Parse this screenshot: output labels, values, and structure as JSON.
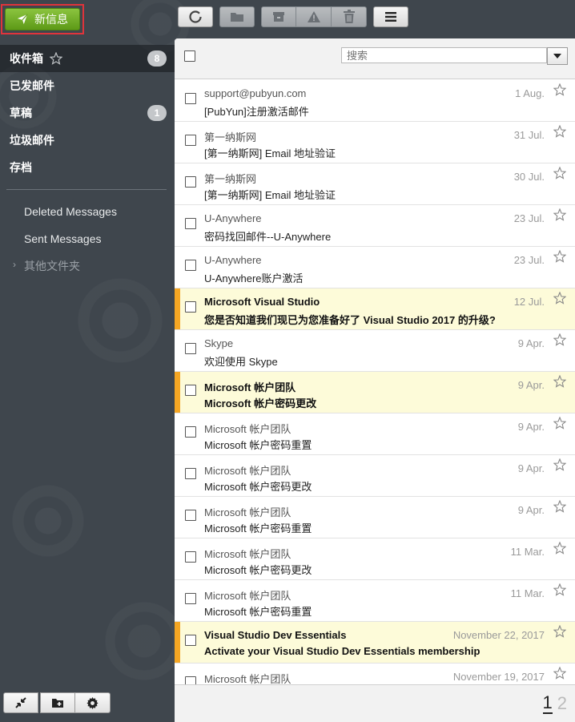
{
  "compose": {
    "label": "新信息"
  },
  "toolbar": {
    "buttons": [
      "refresh-icon",
      "folder-icon",
      "archive-icon",
      "spam-icon",
      "trash-icon",
      "menu-icon"
    ]
  },
  "sidebar": {
    "folders": [
      {
        "label": "收件箱",
        "badge": "8",
        "star": true
      },
      {
        "label": "已发邮件",
        "badge": ""
      },
      {
        "label": "草稿",
        "badge": "1"
      },
      {
        "label": "垃圾邮件",
        "badge": ""
      },
      {
        "label": "存档",
        "badge": ""
      }
    ],
    "subfolders": [
      {
        "label": "Deleted Messages"
      },
      {
        "label": "Sent Messages"
      },
      {
        "label": "其他文件夹"
      }
    ]
  },
  "search": {
    "placeholder": "搜索"
  },
  "messages": [
    {
      "from": "support@pubyun.com",
      "subject": "[PubYun]注册激活邮件",
      "date": "1 Aug."
    },
    {
      "from": "第一纳斯网",
      "subject": "[第一纳斯网] Email 地址验证",
      "date": "31 Jul."
    },
    {
      "from": "第一纳斯网",
      "subject": "[第一纳斯网] Email 地址验证",
      "date": "30 Jul."
    },
    {
      "from": "U-Anywhere",
      "subject": "密码找回邮件--U-Anywhere",
      "date": "23 Jul."
    },
    {
      "from": "U-Anywhere",
      "subject": "U-Anywhere账户激活",
      "date": "23 Jul."
    },
    {
      "from": "Microsoft Visual Studio",
      "subject": "您是否知道我们现已为您准备好了 Visual Studio 2017 的升级?",
      "date": "12 Jul."
    },
    {
      "from": "Skype",
      "subject": "欢迎使用 Skype",
      "date": "9 Apr."
    },
    {
      "from": "Microsoft 帐户团队",
      "subject": "Microsoft 帐户密码更改",
      "date": "9 Apr."
    },
    {
      "from": "Microsoft 帐户团队",
      "subject": "Microsoft 帐户密码重置",
      "date": "9 Apr."
    },
    {
      "from": "Microsoft 帐户团队",
      "subject": "Microsoft 帐户密码更改",
      "date": "9 Apr."
    },
    {
      "from": "Microsoft 帐户团队",
      "subject": "Microsoft 帐户密码重置",
      "date": "9 Apr."
    },
    {
      "from": "Microsoft 帐户团队",
      "subject": "Microsoft 帐户密码更改",
      "date": "11 Mar."
    },
    {
      "from": "Microsoft 帐户团队",
      "subject": "Microsoft 帐户密码重置",
      "date": "11 Mar."
    },
    {
      "from": "Visual Studio Dev Essentials",
      "subject": "Activate your Visual Studio Dev Essentials membership",
      "date": "November 22, 2017"
    },
    {
      "from": "Microsoft 帐户团队",
      "subject": "",
      "date": "November 19, 2017"
    }
  ],
  "pager": {
    "pages": [
      "1",
      "2"
    ],
    "current": "1"
  },
  "colors": {
    "accent_green": "#6fae22",
    "flag_orange": "#f5a623",
    "flag_bg": "#fdfbd9",
    "sidebar_bg": "#3f464d"
  }
}
